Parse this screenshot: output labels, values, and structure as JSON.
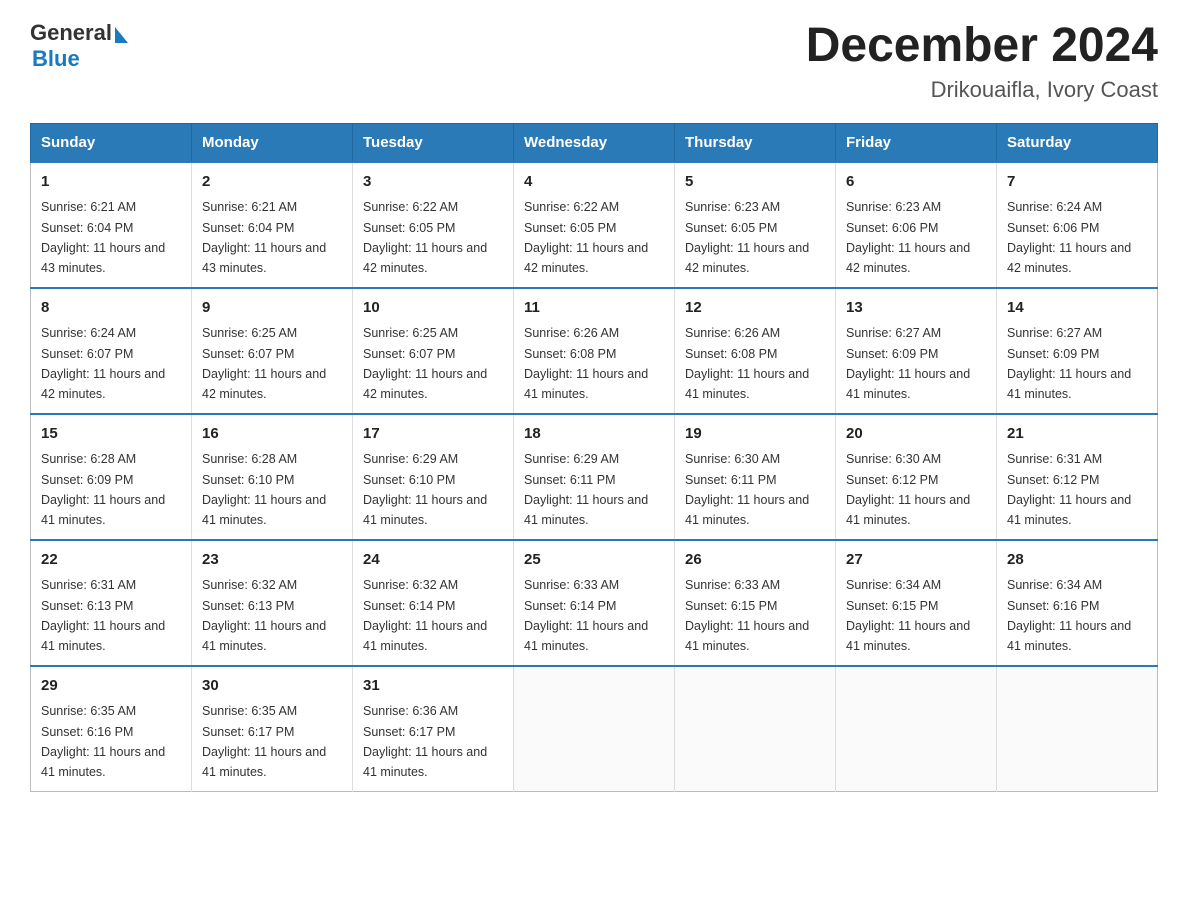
{
  "header": {
    "logo_general": "General",
    "logo_blue": "Blue",
    "title": "December 2024",
    "subtitle": "Drikouaifla, Ivory Coast"
  },
  "weekdays": [
    "Sunday",
    "Monday",
    "Tuesday",
    "Wednesday",
    "Thursday",
    "Friday",
    "Saturday"
  ],
  "weeks": [
    [
      {
        "day": "1",
        "sunrise": "6:21 AM",
        "sunset": "6:04 PM",
        "daylight": "11 hours and 43 minutes."
      },
      {
        "day": "2",
        "sunrise": "6:21 AM",
        "sunset": "6:04 PM",
        "daylight": "11 hours and 43 minutes."
      },
      {
        "day": "3",
        "sunrise": "6:22 AM",
        "sunset": "6:05 PM",
        "daylight": "11 hours and 42 minutes."
      },
      {
        "day": "4",
        "sunrise": "6:22 AM",
        "sunset": "6:05 PM",
        "daylight": "11 hours and 42 minutes."
      },
      {
        "day": "5",
        "sunrise": "6:23 AM",
        "sunset": "6:05 PM",
        "daylight": "11 hours and 42 minutes."
      },
      {
        "day": "6",
        "sunrise": "6:23 AM",
        "sunset": "6:06 PM",
        "daylight": "11 hours and 42 minutes."
      },
      {
        "day": "7",
        "sunrise": "6:24 AM",
        "sunset": "6:06 PM",
        "daylight": "11 hours and 42 minutes."
      }
    ],
    [
      {
        "day": "8",
        "sunrise": "6:24 AM",
        "sunset": "6:07 PM",
        "daylight": "11 hours and 42 minutes."
      },
      {
        "day": "9",
        "sunrise": "6:25 AM",
        "sunset": "6:07 PM",
        "daylight": "11 hours and 42 minutes."
      },
      {
        "day": "10",
        "sunrise": "6:25 AM",
        "sunset": "6:07 PM",
        "daylight": "11 hours and 42 minutes."
      },
      {
        "day": "11",
        "sunrise": "6:26 AM",
        "sunset": "6:08 PM",
        "daylight": "11 hours and 41 minutes."
      },
      {
        "day": "12",
        "sunrise": "6:26 AM",
        "sunset": "6:08 PM",
        "daylight": "11 hours and 41 minutes."
      },
      {
        "day": "13",
        "sunrise": "6:27 AM",
        "sunset": "6:09 PM",
        "daylight": "11 hours and 41 minutes."
      },
      {
        "day": "14",
        "sunrise": "6:27 AM",
        "sunset": "6:09 PM",
        "daylight": "11 hours and 41 minutes."
      }
    ],
    [
      {
        "day": "15",
        "sunrise": "6:28 AM",
        "sunset": "6:09 PM",
        "daylight": "11 hours and 41 minutes."
      },
      {
        "day": "16",
        "sunrise": "6:28 AM",
        "sunset": "6:10 PM",
        "daylight": "11 hours and 41 minutes."
      },
      {
        "day": "17",
        "sunrise": "6:29 AM",
        "sunset": "6:10 PM",
        "daylight": "11 hours and 41 minutes."
      },
      {
        "day": "18",
        "sunrise": "6:29 AM",
        "sunset": "6:11 PM",
        "daylight": "11 hours and 41 minutes."
      },
      {
        "day": "19",
        "sunrise": "6:30 AM",
        "sunset": "6:11 PM",
        "daylight": "11 hours and 41 minutes."
      },
      {
        "day": "20",
        "sunrise": "6:30 AM",
        "sunset": "6:12 PM",
        "daylight": "11 hours and 41 minutes."
      },
      {
        "day": "21",
        "sunrise": "6:31 AM",
        "sunset": "6:12 PM",
        "daylight": "11 hours and 41 minutes."
      }
    ],
    [
      {
        "day": "22",
        "sunrise": "6:31 AM",
        "sunset": "6:13 PM",
        "daylight": "11 hours and 41 minutes."
      },
      {
        "day": "23",
        "sunrise": "6:32 AM",
        "sunset": "6:13 PM",
        "daylight": "11 hours and 41 minutes."
      },
      {
        "day": "24",
        "sunrise": "6:32 AM",
        "sunset": "6:14 PM",
        "daylight": "11 hours and 41 minutes."
      },
      {
        "day": "25",
        "sunrise": "6:33 AM",
        "sunset": "6:14 PM",
        "daylight": "11 hours and 41 minutes."
      },
      {
        "day": "26",
        "sunrise": "6:33 AM",
        "sunset": "6:15 PM",
        "daylight": "11 hours and 41 minutes."
      },
      {
        "day": "27",
        "sunrise": "6:34 AM",
        "sunset": "6:15 PM",
        "daylight": "11 hours and 41 minutes."
      },
      {
        "day": "28",
        "sunrise": "6:34 AM",
        "sunset": "6:16 PM",
        "daylight": "11 hours and 41 minutes."
      }
    ],
    [
      {
        "day": "29",
        "sunrise": "6:35 AM",
        "sunset": "6:16 PM",
        "daylight": "11 hours and 41 minutes."
      },
      {
        "day": "30",
        "sunrise": "6:35 AM",
        "sunset": "6:17 PM",
        "daylight": "11 hours and 41 minutes."
      },
      {
        "day": "31",
        "sunrise": "6:36 AM",
        "sunset": "6:17 PM",
        "daylight": "11 hours and 41 minutes."
      },
      null,
      null,
      null,
      null
    ]
  ]
}
